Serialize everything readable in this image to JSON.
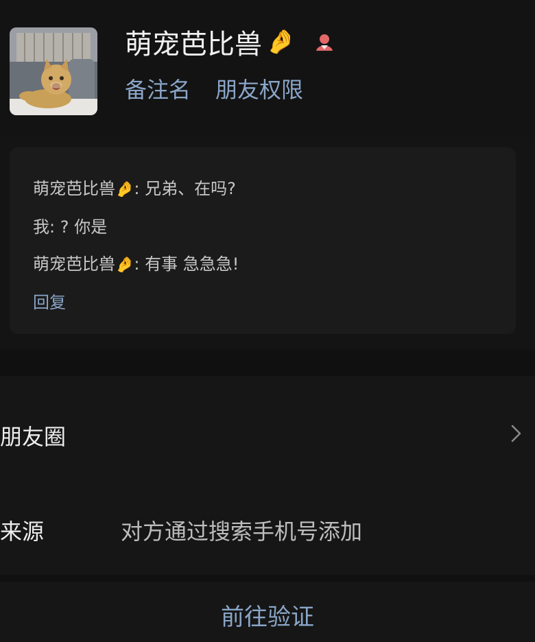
{
  "profile": {
    "name": "萌宠芭比兽",
    "name_emoji": "🤌",
    "gender_icon": "female-icon",
    "links": [
      "备注名",
      "朋友权限"
    ]
  },
  "messages": [
    {
      "sender": "萌宠芭比兽",
      "emoji": "🤌",
      "text": ": 兄弟、在吗?"
    },
    {
      "sender": "我",
      "emoji": "",
      "text": ": ? 你是"
    },
    {
      "sender": "萌宠芭比兽",
      "emoji": "🤌",
      "text": ": 有事 急急急!"
    }
  ],
  "reply_label": "回复",
  "rows": {
    "moments_label": "朋友圈",
    "source_label": "来源",
    "source_value": "对方通过搜索手机号添加"
  },
  "verify_button": "前往验证",
  "colors": {
    "background": "#141414",
    "link": "#8aa6c8",
    "card": "#1b1b1b"
  }
}
